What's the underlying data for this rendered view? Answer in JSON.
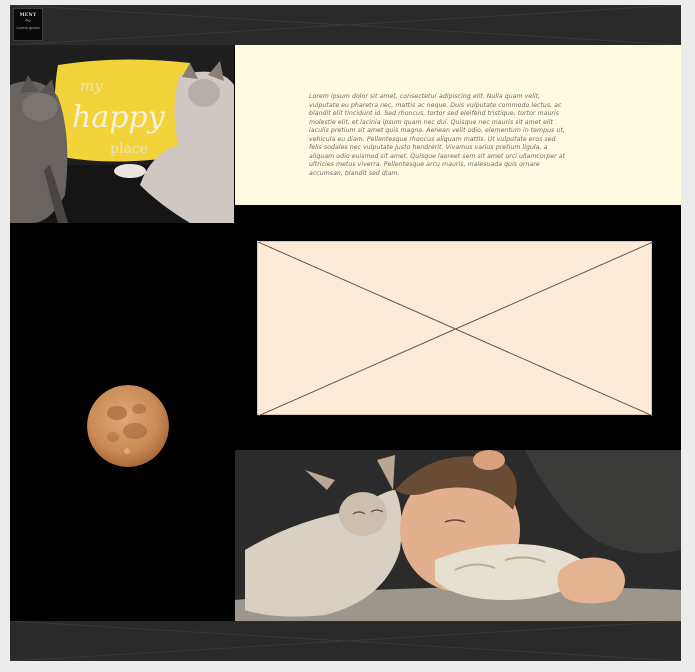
{
  "header": {
    "menu_title": "MENY",
    "menu_icon": "bird-logo-icon",
    "menu_sub": "Lorem ipsum"
  },
  "photos": {
    "cats_pillow": {
      "pillow_text_1": "my",
      "pillow_text_2": "happy",
      "pillow_text_3": "place"
    }
  },
  "body_text": "Lorem ipsum dolor sit amet, consectetur adipiscing elit. Nulla quam velit, vulputate eu pharetra nec, mattis ac neque. Duis vulputate commodo lectus, ac blandit elit tincidunt id. Sed rhoncus, tortor sed eleifend tristique, tortor mauris molestie elit, et lacinia ipsum quam nec dui. Quisque nec mauris sit amet elit iaculis pretium sit amet quis magna. Aenean velit odio, elementum in tempus ut, vehicula eu diam. Pellentesque rhoncus aliquam mattis. Ut vulputate eros sed felis sodales nec vulputate justo hendrerit. Vivamus varius pretium ligula, a aliquam odio euismod sit amet. Quisque laoreet sem sit amet orci ullamcorper at ultricies metus viverra. Pellentesque arcu mauris, malesuada quis ornare accumsan, blandit sed diam.",
  "colors": {
    "page_bg": "#ececec",
    "canvas_bg": "#000000",
    "band_bg": "#2a2a2a",
    "text_card_bg": "#fefbe0",
    "placeholder_bg": "#fdebd7",
    "pillow_yellow": "#f2d43a",
    "moon_orange": "#c98a55"
  }
}
